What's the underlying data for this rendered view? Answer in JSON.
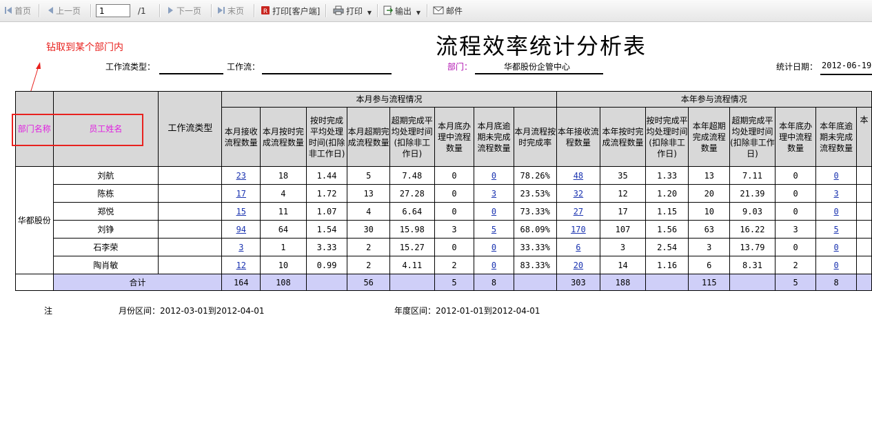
{
  "toolbar": {
    "first": "首页",
    "prev": "上一页",
    "page_value": "1",
    "page_total": "/1",
    "next": "下一页",
    "last": "末页",
    "print_client": "打印[客户端]",
    "print": "打印",
    "export": "输出",
    "mail": "邮件"
  },
  "report": {
    "title": "流程效率统计分析表",
    "annotation": "钻取到某个部门内",
    "filters": {
      "workflow_type_label": "工作流类型：",
      "workflow_type_value": "",
      "workflow_label": "工作流：",
      "workflow_value": "",
      "dept_label": "部门：",
      "dept_value": "华都股份企管中心",
      "date_label": "统计日期：",
      "date_value": "2012-06-19"
    }
  },
  "table": {
    "col_dept": "部门名称",
    "col_name": "员工姓名",
    "col_type": "工作流类型",
    "group_month": "本月参与流程情况",
    "group_year": "本年参与流程情况",
    "month_cols": [
      "本月接收流程数量",
      "本月按时完成流程数量",
      "按时完成平均处理时间(扣除非工作日)",
      "本月超期完成流程数量",
      "超期完成平均处理时间(扣除非工作日)",
      "本月底办理中流程数量",
      "本月底逾期未完成流程数量",
      "本月流程按时完成率"
    ],
    "year_cols": [
      "本年接收流程数量",
      "本年按时完成流程数量",
      "按时完成平均处理时间(扣除非工作日)",
      "本年超期完成流程数量",
      "超期完成平均处理时间(扣除非工作日)",
      "本年底办理中流程数量",
      "本年底逾期未完成流程数量",
      "本"
    ],
    "dept_name": "华都股份",
    "rows": [
      {
        "name": "刘航",
        "m": [
          "23",
          "18",
          "1.44",
          "5",
          "7.48",
          "0",
          "0",
          "78.26%"
        ],
        "y": [
          "48",
          "35",
          "1.33",
          "13",
          "7.11",
          "0",
          "0"
        ]
      },
      {
        "name": "陈栋",
        "m": [
          "17",
          "4",
          "1.72",
          "13",
          "27.28",
          "0",
          "3",
          "23.53%"
        ],
        "y": [
          "32",
          "12",
          "1.20",
          "20",
          "21.39",
          "0",
          "3"
        ]
      },
      {
        "name": "郑悦",
        "m": [
          "15",
          "11",
          "1.07",
          "4",
          "6.64",
          "0",
          "0",
          "73.33%"
        ],
        "y": [
          "27",
          "17",
          "1.15",
          "10",
          "9.03",
          "0",
          "0"
        ]
      },
      {
        "name": "刘铮",
        "m": [
          "94",
          "64",
          "1.54",
          "30",
          "15.98",
          "3",
          "5",
          "68.09%"
        ],
        "y": [
          "170",
          "107",
          "1.56",
          "63",
          "16.22",
          "3",
          "5"
        ]
      },
      {
        "name": "石李荣",
        "m": [
          "3",
          "1",
          "3.33",
          "2",
          "15.27",
          "0",
          "0",
          "33.33%"
        ],
        "y": [
          "6",
          "3",
          "2.54",
          "3",
          "13.79",
          "0",
          "0"
        ]
      },
      {
        "name": "陶肖敏",
        "m": [
          "12",
          "10",
          "0.99",
          "2",
          "4.11",
          "2",
          "0",
          "83.33%"
        ],
        "y": [
          "20",
          "14",
          "1.16",
          "6",
          "8.31",
          "2",
          "0"
        ]
      }
    ],
    "total_label": "合计",
    "total_m": [
      "164",
      "108",
      "",
      "56",
      "",
      "5",
      "8",
      ""
    ],
    "total_y": [
      "303",
      "188",
      "",
      "115",
      "",
      "5",
      "8"
    ]
  },
  "notes": {
    "note_label": "注",
    "month_range": "月份区间：2012-03-01到2012-04-01",
    "year_range": "年度区间：2012-01-01到2012-04-01"
  },
  "colors": {
    "accent_red": "#e8211e",
    "header_gray": "#d8d8d8",
    "total_row": "#cfcff8",
    "link_blue": "#1a33b0",
    "dept_label": "#b010b0",
    "pink_header": "#e020e0"
  }
}
